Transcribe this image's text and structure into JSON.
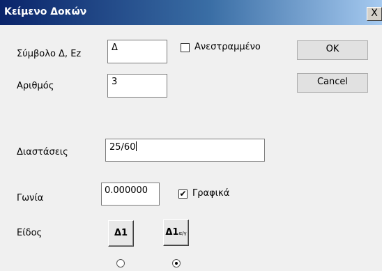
{
  "window": {
    "title": "Κείμενο Δοκών",
    "close_glyph": "X"
  },
  "form": {
    "symbol_label": "Σύμβολο Δ, Ez",
    "symbol_value": "Δ",
    "inverted_label": "Ανεστραμμένο",
    "inverted_checked": false,
    "number_label": "Αριθμός",
    "number_value": "3",
    "dimensions_label": "Διαστάσεις",
    "dimensions_value": "25/60",
    "angle_label": "Γωνία",
    "angle_value": "0.000000",
    "graphic_label": "Γραφικά",
    "graphic_checked": true,
    "type_label": "Είδος",
    "type_options": [
      {
        "main": "Δ1",
        "sub": "",
        "selected": false
      },
      {
        "main": "Δ1",
        "sub": "α/γ",
        "selected": true
      }
    ]
  },
  "buttons": {
    "ok": "OK",
    "cancel": "Cancel"
  }
}
